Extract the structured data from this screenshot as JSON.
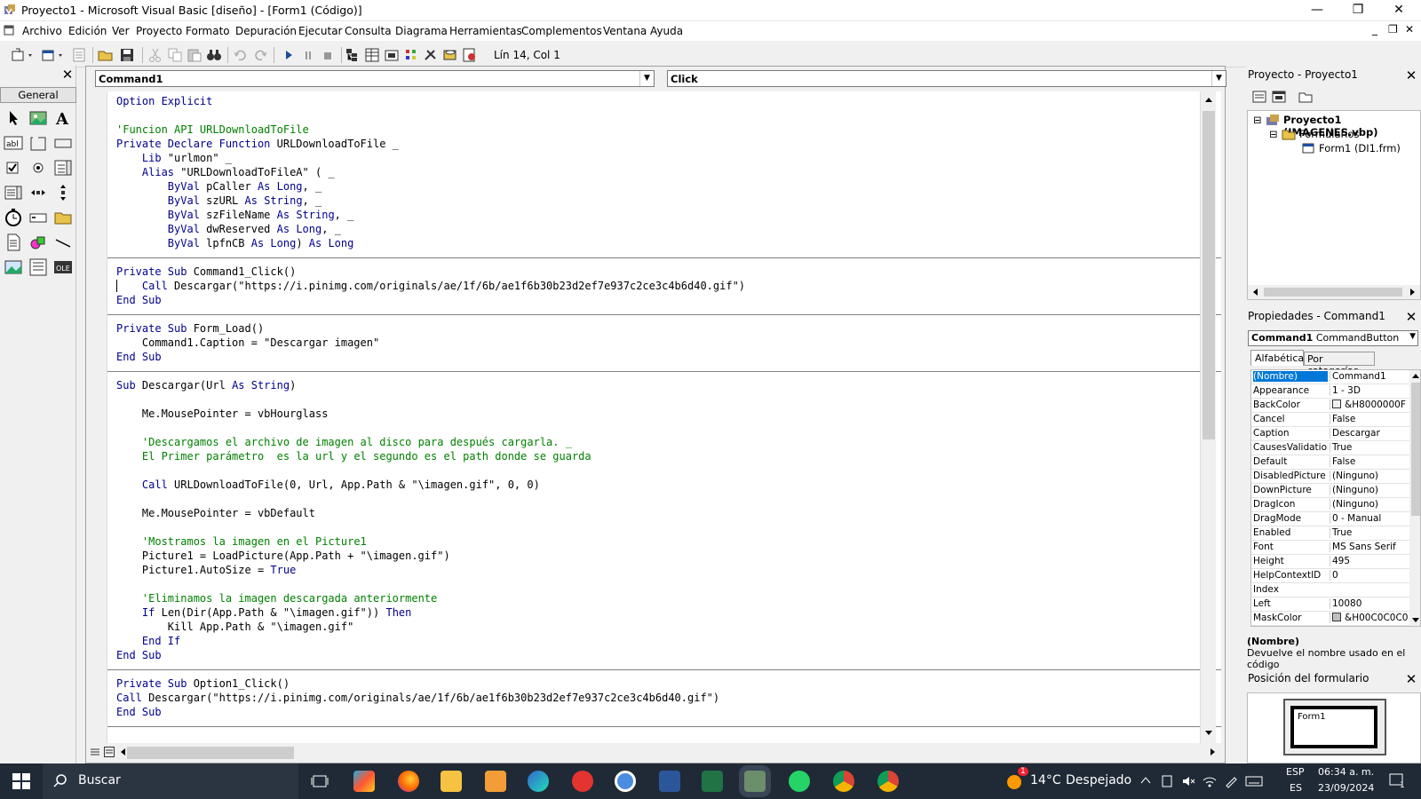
{
  "window": {
    "title": "Proyecto1 - Microsoft Visual Basic [diseño] - [Form1 (Código)]",
    "minimize_glyph": "—",
    "restore_glyph": "❐",
    "close_glyph": "✕"
  },
  "menu": {
    "items": [
      "Archivo",
      "Edición",
      "Ver",
      "Proyecto",
      "Formato",
      "Depuración",
      "Ejecutar",
      "Consulta",
      "Diagrama",
      "Herramientas",
      "Complementos",
      "Ventana",
      "Ayuda"
    ],
    "mdi_controls": [
      "_",
      "❐",
      "✕"
    ]
  },
  "toolbar": {
    "position_text": "Lín 14, Col 1",
    "icons": [
      "add-project-icon",
      "add-form-icon",
      "menu-editor-icon",
      "open-icon",
      "save-icon",
      "cut-icon",
      "copy-icon",
      "paste-icon",
      "find-icon",
      "undo-icon",
      "redo-icon",
      "run-icon",
      "pause-icon",
      "stop-icon",
      "project-explorer-icon",
      "properties-window-icon",
      "form-layout-icon",
      "object-browser-icon",
      "toolbox-icon",
      "data-view-icon",
      "component-manager-icon"
    ]
  },
  "toolbox": {
    "tab_label": "General",
    "close_glyph": "✕"
  },
  "code_window": {
    "object_combo": "Command1",
    "procedure_combo": "Click",
    "arrow_glyph": "▼"
  },
  "code": {
    "block1": [
      [
        [
          "k",
          "Option Explicit"
        ]
      ],
      [],
      [
        [
          "c",
          "'Funcion API URLDownloadToFile"
        ]
      ],
      [
        [
          "k",
          "Private Declare Function "
        ],
        [
          "t",
          "URLDownloadToFile _"
        ]
      ],
      [
        [
          "t",
          "    "
        ],
        [
          "k",
          "Lib "
        ],
        [
          "t",
          "\"urlmon\" _"
        ]
      ],
      [
        [
          "t",
          "    "
        ],
        [
          "k",
          "Alias "
        ],
        [
          "t",
          "\"URLDownloadToFileA\" ( _"
        ]
      ],
      [
        [
          "t",
          "        "
        ],
        [
          "k",
          "ByVal "
        ],
        [
          "t",
          "pCaller "
        ],
        [
          "k",
          "As Long"
        ],
        [
          "t",
          ", _"
        ]
      ],
      [
        [
          "t",
          "        "
        ],
        [
          "k",
          "ByVal "
        ],
        [
          "t",
          "szURL "
        ],
        [
          "k",
          "As String"
        ],
        [
          "t",
          ", _"
        ]
      ],
      [
        [
          "t",
          "        "
        ],
        [
          "k",
          "ByVal "
        ],
        [
          "t",
          "szFileName "
        ],
        [
          "k",
          "As String"
        ],
        [
          "t",
          ", _"
        ]
      ],
      [
        [
          "t",
          "        "
        ],
        [
          "k",
          "ByVal "
        ],
        [
          "t",
          "dwReserved "
        ],
        [
          "k",
          "As Long"
        ],
        [
          "t",
          ", _"
        ]
      ],
      [
        [
          "t",
          "        "
        ],
        [
          "k",
          "ByVal "
        ],
        [
          "t",
          "lpfnCB "
        ],
        [
          "k",
          "As Long"
        ],
        [
          "t",
          ") "
        ],
        [
          "k",
          "As Long"
        ]
      ]
    ],
    "block2": [
      [
        [
          "k",
          "Private Sub "
        ],
        [
          "t",
          "Command1_Click()"
        ]
      ],
      [
        [
          "t",
          "    "
        ],
        [
          "k",
          "Call "
        ],
        [
          "t",
          "Descargar(\"https://i.pinimg.com/originals/ae/1f/6b/ae1f6b30b23d2ef7e937c2ce3c4b6d40.gif\")"
        ]
      ],
      [
        [
          "k",
          "End Sub"
        ]
      ]
    ],
    "block3": [
      [
        [
          "k",
          "Private Sub "
        ],
        [
          "t",
          "Form_Load()"
        ]
      ],
      [
        [
          "t",
          "    Command1.Caption = \"Descargar imagen\""
        ]
      ],
      [
        [
          "k",
          "End Sub"
        ]
      ]
    ],
    "block4": [
      [
        [
          "k",
          "Sub "
        ],
        [
          "t",
          "Descargar(Url "
        ],
        [
          "k",
          "As String"
        ],
        [
          "t",
          ")"
        ]
      ],
      [],
      [
        [
          "t",
          "    Me.MousePointer = vbHourglass"
        ]
      ],
      [],
      [
        [
          "t",
          "    "
        ],
        [
          "c",
          "'Descargamos el archivo de imagen al disco para después cargarla. _"
        ]
      ],
      [
        [
          "t",
          "    "
        ],
        [
          "c",
          "El Primer parámetro  es la url y el segundo es el path donde se guarda"
        ]
      ],
      [],
      [
        [
          "t",
          "    "
        ],
        [
          "k",
          "Call "
        ],
        [
          "t",
          "URLDownloadToFile(0, Url, App.Path & \"\\imagen.gif\", 0, 0)"
        ]
      ],
      [],
      [
        [
          "t",
          "    Me.MousePointer = vbDefault"
        ]
      ],
      [],
      [
        [
          "t",
          "    "
        ],
        [
          "c",
          "'Mostramos la imagen en el Picture1"
        ]
      ],
      [
        [
          "t",
          "    Picture1 = LoadPicture(App.Path + \"\\imagen.gif\")"
        ]
      ],
      [
        [
          "t",
          "    Picture1.AutoSize = "
        ],
        [
          "k",
          "True"
        ]
      ],
      [],
      [
        [
          "t",
          "    "
        ],
        [
          "c",
          "'Eliminamos la imagen descargada anteriormente"
        ]
      ],
      [
        [
          "t",
          "    "
        ],
        [
          "k",
          "If "
        ],
        [
          "t",
          "Len(Dir(App.Path & \"\\imagen.gif\")) "
        ],
        [
          "k",
          "Then"
        ]
      ],
      [
        [
          "t",
          "        Kill App.Path & \"\\imagen.gif\""
        ]
      ],
      [
        [
          "t",
          "    "
        ],
        [
          "k",
          "End If"
        ]
      ],
      [
        [
          "k",
          "End Sub"
        ]
      ]
    ],
    "block5": [
      [
        [
          "k",
          "Private Sub "
        ],
        [
          "t",
          "Option1_Click()"
        ]
      ],
      [
        [
          "k",
          "Call "
        ],
        [
          "t",
          "Descargar(\"https://i.pinimg.com/originals/ae/1f/6b/ae1f6b30b23d2ef7e937c2ce3c4b6d40.gif\")"
        ]
      ],
      [
        [
          "k",
          "End Sub"
        ]
      ]
    ]
  },
  "project": {
    "title": "Proyecto - Proyecto1",
    "root": "Proyecto1 (IMAGENES.vbp)",
    "folder": "Formularios",
    "form": "Form1 (DI1.frm)",
    "tree_toggle_root": "⊟",
    "tree_toggle_folder": "⊟"
  },
  "properties": {
    "title": "Propiedades - Command1",
    "object_name": "Command1",
    "object_type": "CommandButton",
    "tabs": [
      "Alfabética",
      "Por categorías"
    ],
    "rows": [
      {
        "name": "(Nombre)",
        "value": "Command1",
        "selected": true
      },
      {
        "name": "Appearance",
        "value": "1 - 3D"
      },
      {
        "name": "BackColor",
        "value": "&H8000000F",
        "swatch": "#f0f0f0"
      },
      {
        "name": "Cancel",
        "value": "False"
      },
      {
        "name": "Caption",
        "value": "Descargar"
      },
      {
        "name": "CausesValidation",
        "value": "True"
      },
      {
        "name": "Default",
        "value": "False"
      },
      {
        "name": "DisabledPicture",
        "value": "(Ninguno)"
      },
      {
        "name": "DownPicture",
        "value": "(Ninguno)"
      },
      {
        "name": "DragIcon",
        "value": "(Ninguno)"
      },
      {
        "name": "DragMode",
        "value": "0 - Manual"
      },
      {
        "name": "Enabled",
        "value": "True"
      },
      {
        "name": "Font",
        "value": "MS Sans Serif"
      },
      {
        "name": "Height",
        "value": "495"
      },
      {
        "name": "HelpContextID",
        "value": "0"
      },
      {
        "name": "Index",
        "value": ""
      },
      {
        "name": "Left",
        "value": "10080"
      },
      {
        "name": "MaskColor",
        "value": "&H00C0C0C0",
        "swatch": "#c0c0c0"
      }
    ],
    "desc_title": "(Nombre)",
    "desc_text": "Devuelve el nombre usado en el código"
  },
  "form_layout": {
    "title": "Posición del formulario",
    "form_label": "Form1"
  },
  "taskbar": {
    "search_placeholder": "Buscar",
    "weather_temp": "14°C",
    "weather_desc": "Despejado",
    "lang_top": "ESP",
    "lang_bottom": "ES",
    "time": "06:34 a. m.",
    "date": "23/09/2024",
    "notification_count": "1",
    "weather_badge": "1"
  },
  "colors": {
    "keyword": "#00008b",
    "comment": "#008000",
    "selection": "#0078d7",
    "taskbar": "#1f2a36"
  }
}
